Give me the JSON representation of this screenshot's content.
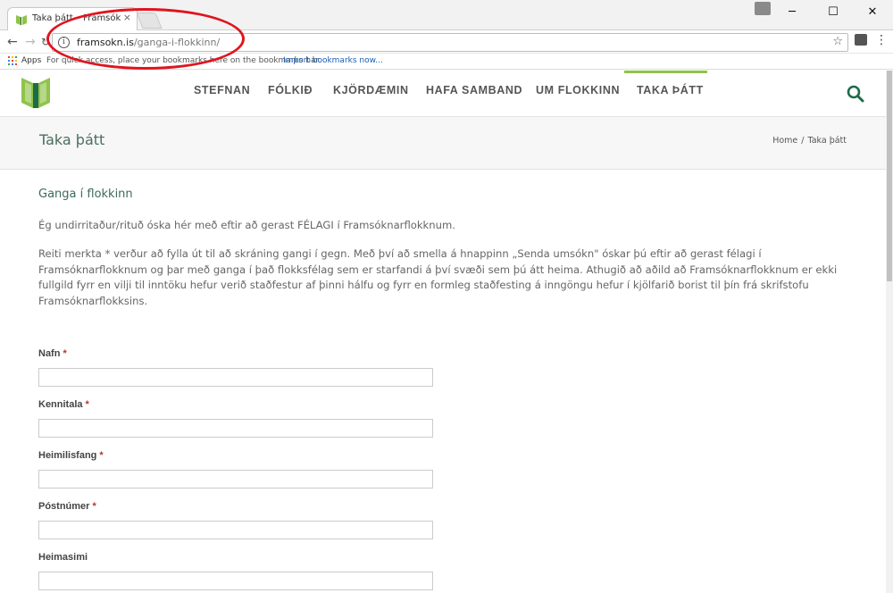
{
  "browser": {
    "tab_title": "Taka þátt – Framsókn",
    "tab_close": "×",
    "url_host": "framsokn.is",
    "url_path": "/ganga-i-flokkinn/",
    "info_glyph": "i",
    "star_glyph": "☆",
    "back_glyph": "←",
    "forward_glyph": "→",
    "reload_glyph": "↻",
    "menu_glyph": "⋮",
    "minimize_glyph": "─",
    "maximize_glyph": "☐",
    "close_glyph": "✕",
    "bookmarks_apps": "Apps",
    "bookmarks_text": "For quick access, place your bookmarks here on the bookmarks bar.",
    "bookmarks_link": "Import bookmarks now...",
    "highlight_color": "#e0141e"
  },
  "site": {
    "nav": [
      "STEFNAN",
      "FÓLKIÐ",
      "KJÖRDÆMIN",
      "HAFA SAMBAND",
      "UM FLOKKINN",
      "TAKA ÞÁTT"
    ],
    "active_nav_index": 5,
    "accent_green": "#90c34b",
    "brand_green": "#1e6b4a",
    "icons": {
      "search": "search-icon",
      "logo": "logo-icon"
    }
  },
  "title_bar": {
    "page_title": "Taka þátt",
    "breadcrumb_home": "Home",
    "breadcrumb_sep": "/",
    "breadcrumb_current": "Taka þátt"
  },
  "content": {
    "heading": "Ganga í flokkinn",
    "para1": "Ég undirritaður/rituð óska hér með eftir að gerast FÉLAGI í Framsóknarflokknum.",
    "para2": "Reiti merkta * verður að fylla út til að skráning gangi í gegn. Með því að smella á hnappinn „Senda umsókn\" óskar þú eftir að gerast félagi í Framsóknarflokknum og þar með ganga í það flokksfélag sem er starfandi á því svæði sem þú átt heima. Athugið að aðild að Framsóknarflokknum er ekki fullgild fyrr en vilji til inntöku hefur verið staðfestur af þinni hálfu og fyrr en formleg staðfesting á inngöngu hefur í kjölfarið borist til þín frá skrifstofu Framsóknarflokksins."
  },
  "form": {
    "fields": [
      {
        "label": "Nafn",
        "required": "*",
        "value": ""
      },
      {
        "label": "Kennitala",
        "required": "*",
        "value": ""
      },
      {
        "label": "Heimilisfang",
        "required": "*",
        "value": ""
      },
      {
        "label": "Póstnúmer",
        "required": "*",
        "value": ""
      },
      {
        "label": "Heimasimi",
        "required": "",
        "value": ""
      }
    ]
  }
}
